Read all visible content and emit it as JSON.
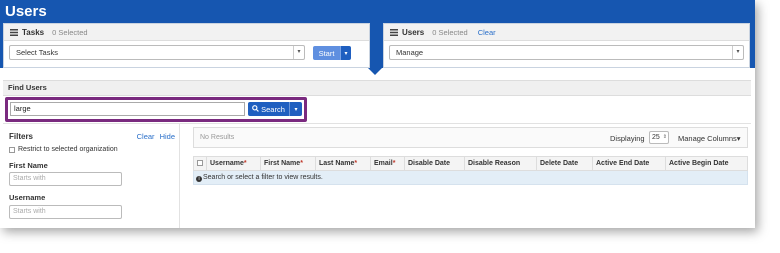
{
  "header": {
    "title": "Users"
  },
  "tasks_panel": {
    "title": "Tasks",
    "count": "0 Selected",
    "select_value": "Select Tasks",
    "start_label": "Start"
  },
  "users_panel": {
    "title": "Users",
    "count": "0 Selected",
    "clear_label": "Clear",
    "select_value": "Manage"
  },
  "find_users": {
    "title": "Find Users",
    "query": "large",
    "search_label": "Search"
  },
  "filters": {
    "title": "Filters",
    "clear_label": "Clear",
    "hide_label": "Hide",
    "restrict_label": "Restrict to selected organization",
    "first_name_label": "First Name",
    "first_name_placeholder": "Starts with",
    "username_label": "Username",
    "username_placeholder": "Starts with"
  },
  "results": {
    "status": "No Results",
    "displaying_label": "Displaying",
    "page_size": "25",
    "manage_columns_label": "Manage Columns"
  },
  "table": {
    "columns": [
      {
        "label": "Username",
        "required": true
      },
      {
        "label": "First Name",
        "required": true
      },
      {
        "label": "Last Name",
        "required": true
      },
      {
        "label": "Email",
        "required": true
      },
      {
        "label": "Disable Date",
        "required": false
      },
      {
        "label": "Disable Reason",
        "required": false
      },
      {
        "label": "Delete Date",
        "required": false
      },
      {
        "label": "Active End Date",
        "required": false
      },
      {
        "label": "Active Begin Date",
        "required": false
      }
    ],
    "empty_message": "Search or select a filter to view results."
  },
  "colors": {
    "header_blue": "#1656b0",
    "button_blue": "#1f5fc0",
    "highlight_purple": "#7a2a7f",
    "link_blue": "#2a6fc9"
  }
}
